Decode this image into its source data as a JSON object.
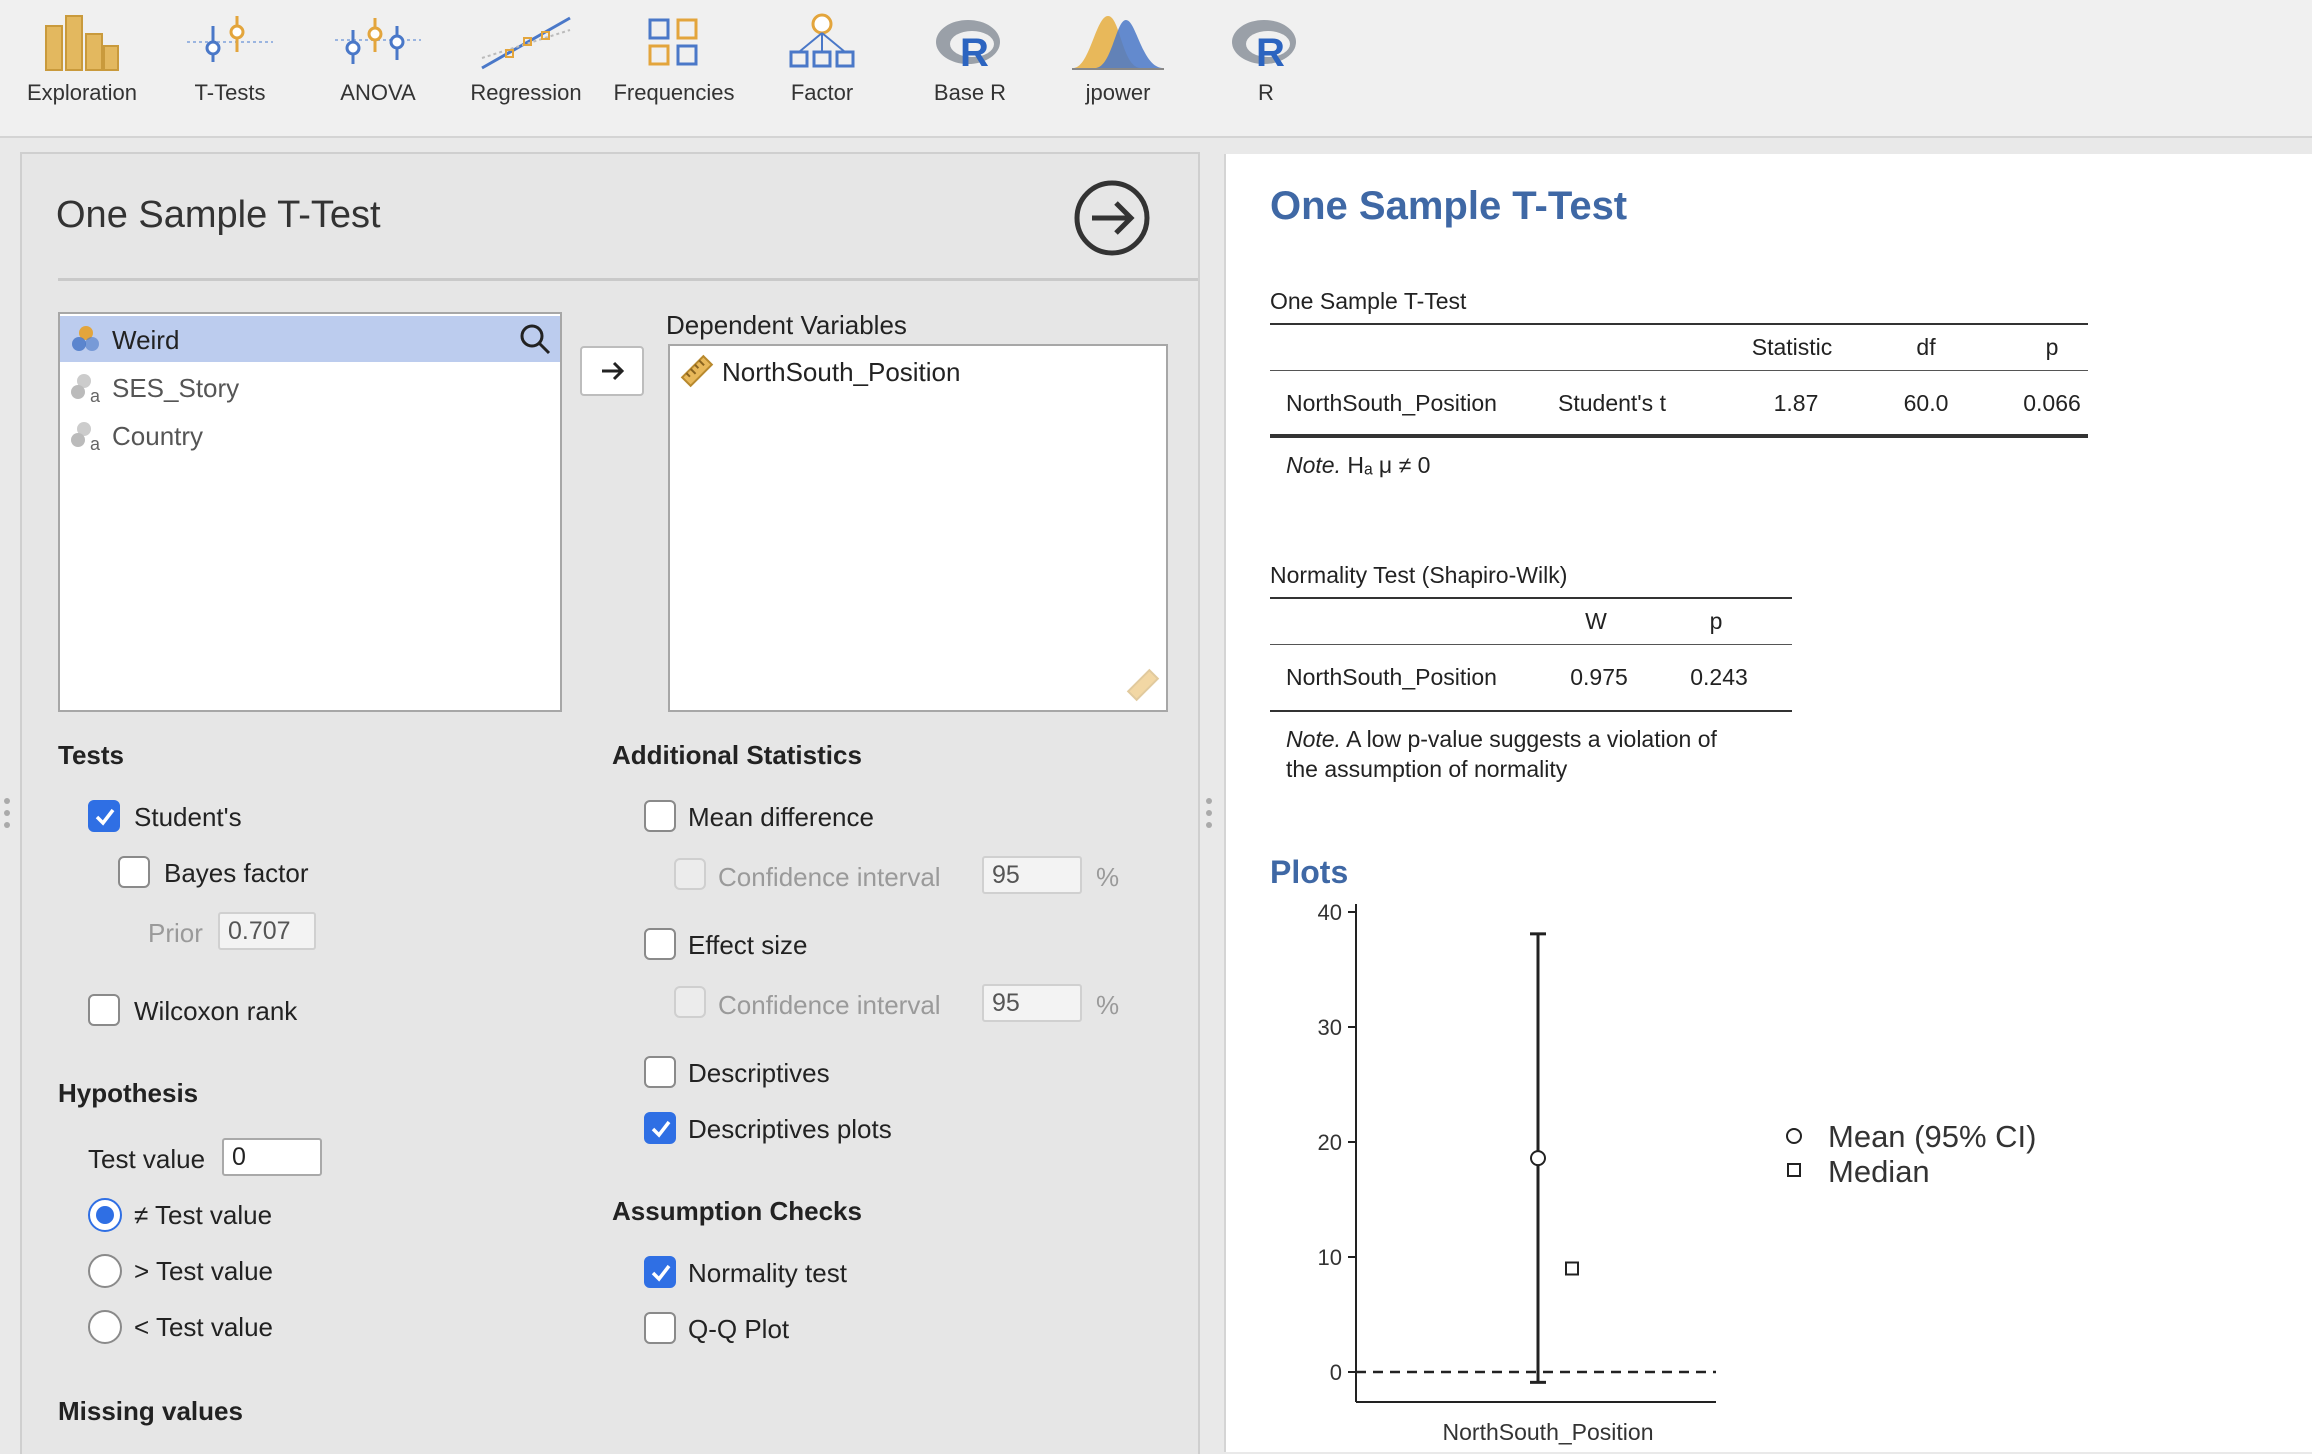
{
  "toolbar": {
    "items": [
      {
        "label": "Exploration",
        "icon": "bar-chart-icon"
      },
      {
        "label": "T-Tests",
        "icon": "t-tests-icon"
      },
      {
        "label": "ANOVA",
        "icon": "anova-icon"
      },
      {
        "label": "Regression",
        "icon": "regression-icon"
      },
      {
        "label": "Frequencies",
        "icon": "frequencies-icon"
      },
      {
        "label": "Factor",
        "icon": "factor-icon"
      },
      {
        "label": "Base R",
        "icon": "r-logo-icon"
      },
      {
        "label": "jpower",
        "icon": "jpower-icon"
      },
      {
        "label": "R",
        "icon": "r-logo-icon"
      }
    ]
  },
  "options": {
    "title": "One Sample T-Test",
    "variables": [
      {
        "name": "Weird",
        "selected": true
      },
      {
        "name": "SES_Story",
        "selected": false
      },
      {
        "name": "Country",
        "selected": false
      }
    ],
    "dependent_label": "Dependent Variables",
    "dependent_vars": [
      "NorthSouth_Position"
    ],
    "tests": {
      "heading": "Tests",
      "students": "Student's",
      "bayes": "Bayes factor",
      "prior_label": "Prior",
      "prior_value": "0.707",
      "wilcoxon": "Wilcoxon rank"
    },
    "hypothesis": {
      "heading": "Hypothesis",
      "test_value_label": "Test value",
      "test_value": "0",
      "ne": "≠ Test value",
      "gt": "> Test value",
      "lt": "< Test value"
    },
    "missing": "Missing values",
    "additional": {
      "heading": "Additional Statistics",
      "mean_diff": "Mean difference",
      "ci_label": "Confidence interval",
      "ci_value": "95",
      "pct": "%",
      "effect_size": "Effect size",
      "ci_label2": "Confidence interval",
      "ci_value2": "95",
      "pct2": "%",
      "descriptives": "Descriptives",
      "desc_plots": "Descriptives plots"
    },
    "assumptions": {
      "heading": "Assumption Checks",
      "normality": "Normality test",
      "qq": "Q-Q Plot"
    }
  },
  "results": {
    "title": "One Sample T-Test",
    "ttest": {
      "caption": "One Sample T-Test",
      "headers": [
        "Statistic",
        "df",
        "p"
      ],
      "row": {
        "var": "NorthSouth_Position",
        "test": "Student's t",
        "statistic": "1.87",
        "df": "60.0",
        "p": "0.066"
      },
      "note_label": "Note.",
      "note_text": "Hₐ μ ≠ 0"
    },
    "normality": {
      "caption": "Normality Test (Shapiro-Wilk)",
      "headers": [
        "W",
        "p"
      ],
      "row": {
        "var": "NorthSouth_Position",
        "W": "0.975",
        "p": "0.243"
      },
      "note_label": "Note.",
      "note_line1": "A low p-value suggests a violation of",
      "note_line2": "the assumption of normality"
    },
    "plots_title": "Plots"
  },
  "chart_data": {
    "type": "scatter",
    "categories": [
      "NorthSouth_Position"
    ],
    "series": [
      {
        "name": "Mean (95% CI)",
        "values": [
          18.6
        ],
        "ci": [
          [
            -0.9,
            38.1
          ]
        ]
      },
      {
        "name": "Median",
        "values": [
          9
        ]
      }
    ],
    "reference_line": 0,
    "ylim": [
      0,
      40
    ],
    "yticks": [
      "0",
      "10",
      "20",
      "30",
      "40"
    ],
    "xlabel": "NorthSouth_Position",
    "legend": "right"
  }
}
